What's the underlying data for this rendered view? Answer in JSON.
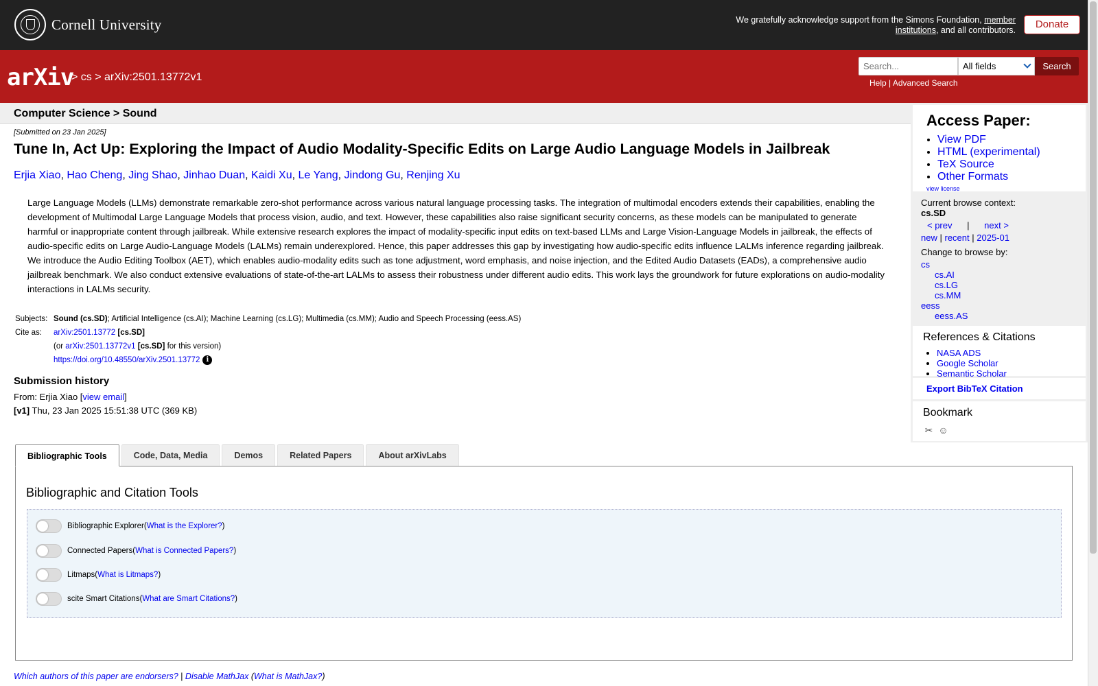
{
  "cornell": {
    "name": "Cornell University"
  },
  "ack": {
    "text_before": "We gratefully acknowledge support from the Simons Foundation, ",
    "link": "member institutions",
    "text_after": ", and all contributors."
  },
  "donate_label": "Donate",
  "header": {
    "logo_text": "arXiv",
    "breadcrumb": "> cs > arXiv:2501.13772v1",
    "search_placeholder": "Search...",
    "field_select": "All fields",
    "search_button": "Search",
    "help": "Help",
    "separator": "|",
    "advanced": "Advanced Search"
  },
  "subheader": "Computer Science > Sound",
  "paper": {
    "submitted": "[Submitted on 23 Jan 2025]",
    "title": "Tune In, Act Up: Exploring the Impact of Audio Modality-Specific Edits on Large Audio Language Models in Jailbreak",
    "authors": [
      "Erjia Xiao",
      "Hao Cheng",
      "Jing Shao",
      "Jinhao Duan",
      "Kaidi Xu",
      "Le Yang",
      "Jindong Gu",
      "Renjing Xu"
    ],
    "abstract": "Large Language Models (LLMs) demonstrate remarkable zero-shot performance across various natural language processing tasks. The integration of multimodal encoders extends their capabilities, enabling the development of Multimodal Large Language Models that process vision, audio, and text. However, these capabilities also raise significant security concerns, as these models can be manipulated to generate harmful or inappropriate content through jailbreak. While extensive research explores the impact of modality-specific input edits on text-based LLMs and Large Vision-Language Models in jailbreak, the effects of audio-specific edits on Large Audio-Language Models (LALMs) remain underexplored. Hence, this paper addresses this gap by investigating how audio-specific edits influence LALMs inference regarding jailbreak. We introduce the Audio Editing Toolbox (AET), which enables audio-modality edits such as tone adjustment, word emphasis, and noise injection, and the Edited Audio Datasets (EADs), a comprehensive audio jailbreak benchmark. We also conduct extensive evaluations of state-of-the-art LALMs to assess their robustness under different audio edits. This work lays the groundwork for future explorations on audio-modality interactions in LALMs security."
  },
  "meta": {
    "subjects_label": "Subjects:",
    "subjects_primary": "Sound (cs.SD)",
    "subjects_rest": "; Artificial Intelligence (cs.AI); Machine Learning (cs.LG); Multimedia (cs.MM); Audio and Speech Processing (eess.AS)",
    "cite_label": "Cite as:",
    "cite_id": "arXiv:2501.13772",
    "cite_cat": "[cs.SD]",
    "or_prefix": "(or ",
    "cite_version": "arXiv:2501.13772v1",
    "or_suffix": " for this version)",
    "doi": "https://doi.org/10.48550/arXiv.2501.13772",
    "info_glyph": "i"
  },
  "history": {
    "heading": "Submission history",
    "from_prefix": "From: Erjia Xiao [",
    "view_email": "view email",
    "from_suffix": "]",
    "v1_label": "[v1]",
    "v1_text": " Thu, 23 Jan 2025 15:51:38 UTC (369 KB)"
  },
  "sidebar": {
    "access_title": "Access Paper:",
    "access_links": [
      "View PDF",
      "HTML (experimental)",
      "TeX Source",
      "Other Formats"
    ],
    "view_license": "view license",
    "browse_context": "Current browse context:",
    "context_value": "cs.SD",
    "prev": "< prev",
    "pipe": "|",
    "next": "next >",
    "new": "new",
    "recent": "recent",
    "month": "2025-01",
    "change_browse": "Change to browse by:",
    "browse_cs": "cs",
    "browse_sub": [
      "cs.AI",
      "cs.LG",
      "cs.MM"
    ],
    "browse_eess": "eess",
    "browse_eess_sub": "eess.AS",
    "refs_title": "References & Citations",
    "refs": [
      "NASA ADS",
      "Google Scholar",
      "Semantic Scholar"
    ],
    "export": "Export BibTeX Citation",
    "bookmark": "Bookmark",
    "bm_icons": [
      "science-wise-icon",
      "reddit-icon"
    ]
  },
  "tabs": [
    "Bibliographic Tools",
    "Code, Data, Media",
    "Demos",
    "Related Papers",
    "About arXivLabs"
  ],
  "panel": {
    "title": "Bibliographic and Citation Tools",
    "tools": [
      {
        "name": "Bibliographic Explorer",
        "link": "What is the Explorer?"
      },
      {
        "name": "Connected Papers",
        "link": "What is Connected Papers?"
      },
      {
        "name": "Litmaps",
        "link": "What is Litmaps?"
      },
      {
        "name": "scite Smart Citations",
        "link": "What are Smart Citations?"
      }
    ]
  },
  "footer": {
    "endorsers": "Which authors of this paper are endorsers?",
    "sep": " | ",
    "mathjax": "Disable MathJax",
    "what_mathjax": "What is MathJax?"
  },
  "colors": {
    "arxiv_red": "#b31b1b",
    "cornell_dark": "#222222",
    "link": "#0000ee"
  }
}
